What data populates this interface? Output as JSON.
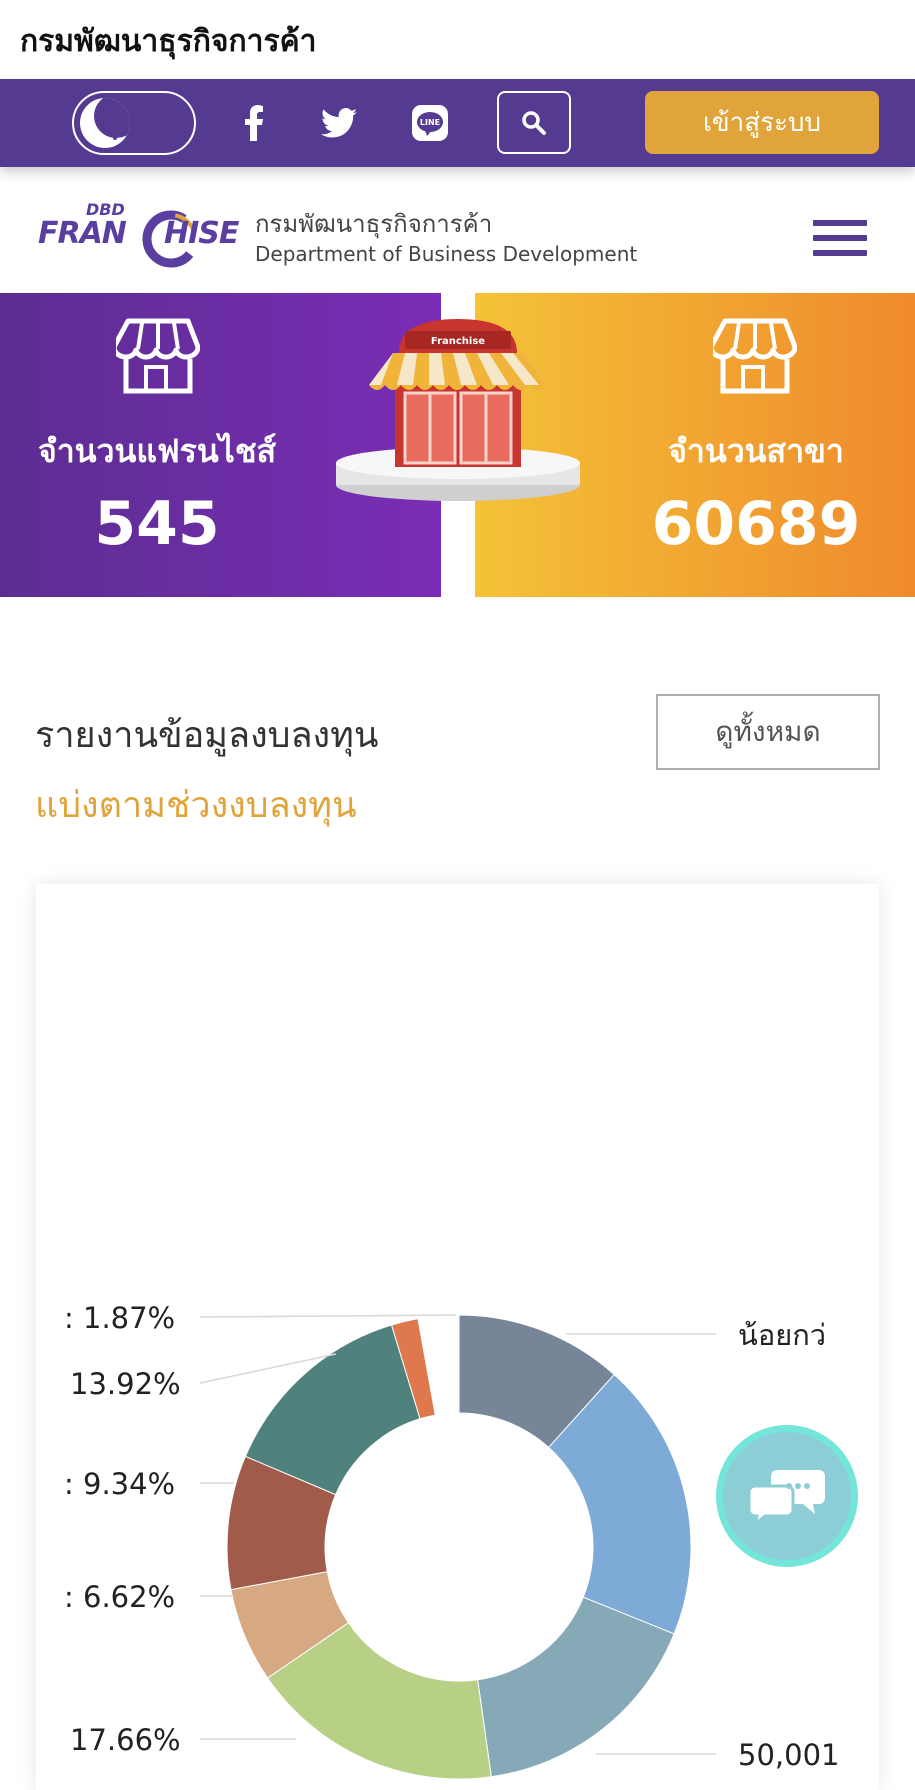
{
  "page": {
    "title": "กรมพัฒนาธุรกิจการค้า"
  },
  "toolbar": {
    "theme_toggle_icon": "moon-icon",
    "social": [
      "facebook-icon",
      "twitter-icon",
      "line-icon"
    ],
    "line_text": "LINE",
    "search_icon": "search-icon",
    "login_label": "เข้าสู่ระบบ",
    "colors": {
      "bar": "#543a91",
      "login": "#e1a43a"
    }
  },
  "brand": {
    "logo_small": "DBD",
    "logo_word_left": "FRAN",
    "logo_word_right": "HISE",
    "name_th": "กรมพัฒนาธุรกิจการค้า",
    "name_en": "Department of Business Development"
  },
  "stats": {
    "franchise_label": "จำนวนแฟรนไชส์",
    "franchise_value": "545",
    "branch_label": "จำนวนสาขา",
    "branch_value": "60689",
    "kiosk_sign": "Franchise"
  },
  "report": {
    "title": "รายงานข้อมูลงบลงทุน",
    "subtitle": "แบ่งตามช่วงงบลงทุน",
    "view_all": "ดูทั้งหมด"
  },
  "chart_data": {
    "type": "pie",
    "donut": true,
    "slices": [
      {
        "label": "",
        "color": "#778599"
      },
      {
        "label": "",
        "color": "#7eaad8"
      },
      {
        "label": "",
        "color": "#86a9b8"
      },
      {
        "label": "",
        "value": 17.66,
        "color": "#b8d086"
      },
      {
        "label": "",
        "value": 6.62,
        "color": "#d6a983"
      },
      {
        "label": "",
        "value": 9.34,
        "color": "#a05b4a"
      },
      {
        "label": "",
        "value": 13.92,
        "color": "#4f827c"
      },
      {
        "label": "",
        "value": 1.87,
        "color": "#e0784d"
      }
    ],
    "visible_labels": [
      {
        "text": ": 1.87%"
      },
      {
        "text": "13.92%"
      },
      {
        "text": ": 9.34%"
      },
      {
        "text": ": 6.62%"
      },
      {
        "text": "17.66%"
      },
      {
        "text": "น้อยกว่"
      },
      {
        "text": "50,001"
      }
    ]
  },
  "chat": {
    "icon": "chat-bubbles-icon"
  }
}
